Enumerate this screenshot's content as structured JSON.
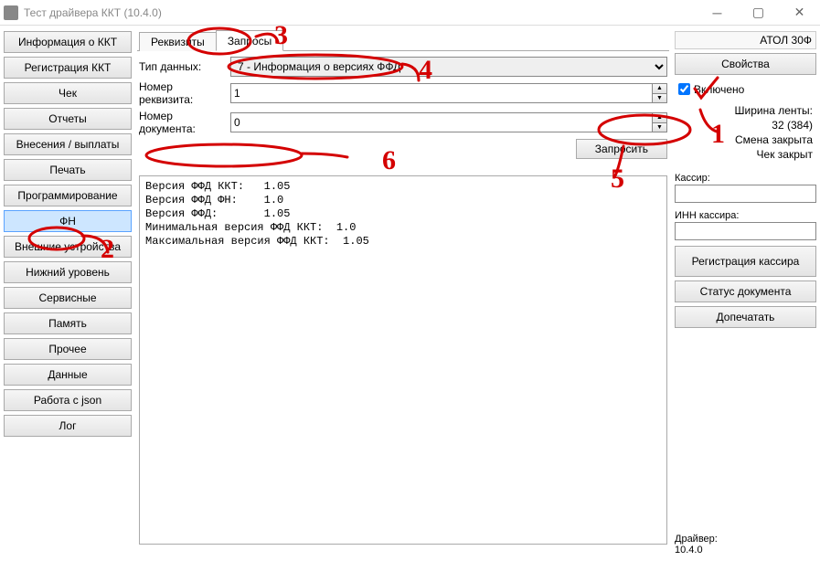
{
  "window": {
    "title": "Тест драйвера ККТ (10.4.0)"
  },
  "sidebar": {
    "items": [
      {
        "label": "Информация о ККТ",
        "selected": false
      },
      {
        "label": "Регистрация ККТ",
        "selected": false
      },
      {
        "label": "Чек",
        "selected": false
      },
      {
        "label": "Отчеты",
        "selected": false
      },
      {
        "label": "Внесения / выплаты",
        "selected": false
      },
      {
        "label": "Печать",
        "selected": false
      },
      {
        "label": "Программирование",
        "selected": false
      },
      {
        "label": "ФН",
        "selected": true
      },
      {
        "label": "Внешние устройства",
        "selected": false
      },
      {
        "label": "Нижний уровень",
        "selected": false
      },
      {
        "label": "Сервисные",
        "selected": false
      },
      {
        "label": "Память",
        "selected": false
      },
      {
        "label": "Прочее",
        "selected": false
      },
      {
        "label": "Данные",
        "selected": false
      },
      {
        "label": "Работа с json",
        "selected": false
      },
      {
        "label": "Лог",
        "selected": false
      }
    ]
  },
  "tabs": {
    "rekvizity": "Реквизиты",
    "zaprosy": "Запросы"
  },
  "form": {
    "tip_dannyh_label": "Тип данных:",
    "tip_dannyh_value": "7 - Информация о версиях ФФД",
    "nomer_rekvizita_label": "Номер реквизита:",
    "nomer_rekvizita_value": "1",
    "nomer_dokumenta_label": "Номер документа:",
    "nomer_dokumenta_value": "0",
    "zaprosit": "Запросить"
  },
  "output_lines": [
    "Версия ФФД ККТ:   1.05",
    "Версия ФФД ФН:    1.0",
    "Версия ФФД:       1.05",
    "Минимальная версия ФФД ККТ:  1.0",
    "Максимальная версия ФФД ККТ:  1.05"
  ],
  "right": {
    "device": "АТОЛ 30Ф",
    "svoystva": "Свойства",
    "vklyucheno": "Включено",
    "shirina_lenty_label": "Ширина ленты:",
    "shirina_lenty_value": "32 (384)",
    "smena": "Смена закрыта",
    "chek": "Чек закрыт",
    "kassir_label": "Кассир:",
    "kassir_value": "",
    "inn_label": "ИНН кассира:",
    "inn_value": "",
    "reg_kassira": "Регистрация кассира",
    "status_doc": "Статус документа",
    "dopechatat": "Допечатать",
    "driver_label": "Драйвер:",
    "driver_value": "10.4.0"
  },
  "annotations": {
    "n1": "1",
    "n2": "2",
    "n3": "3",
    "n4": "4",
    "n5": "5",
    "n6": "6"
  }
}
